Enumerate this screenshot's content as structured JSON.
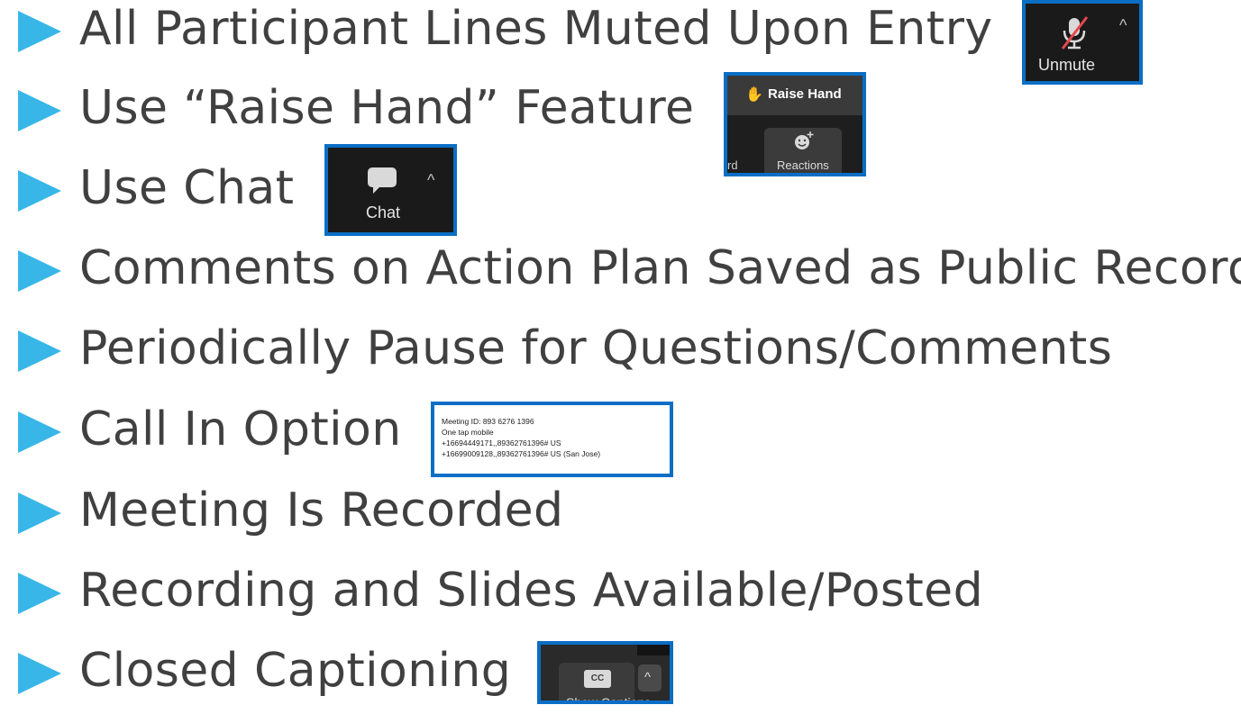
{
  "bullets": [
    "All Participant Lines Muted Upon Entry",
    "Use “Raise Hand” Feature",
    "Use Chat",
    "Comments on Action Plan Saved as Public Record",
    "Periodically Pause for Questions/Comments",
    "Call In Option",
    "Meeting Is Recorded",
    "Recording and Slides Available/Posted",
    "Closed Captioning"
  ],
  "unmute": {
    "label": "Unmute",
    "icon": "muted-mic-icon",
    "caret": "^"
  },
  "raise_hand": {
    "label": "Raise Hand",
    "emoji": "✋",
    "reactions_label": "Reactions",
    "edge_text": "rd"
  },
  "chat": {
    "label": "Chat",
    "icon": "chat-bubble-icon",
    "caret": "^"
  },
  "call_in": {
    "line1": "Meeting ID: 893 6276 1396",
    "line2": "One tap mobile",
    "line3": "+16694449171,,89362761396# US",
    "line4": "+16699009128,,89362761396# US (San Jose)"
  },
  "captions": {
    "badge": "CC",
    "label": "Show Captions",
    "caret": "^"
  },
  "colors": {
    "arrow": "#38b6e8",
    "frame": "#0a6ec5",
    "text": "#404040",
    "dark_panel": "#1a1a1a"
  }
}
